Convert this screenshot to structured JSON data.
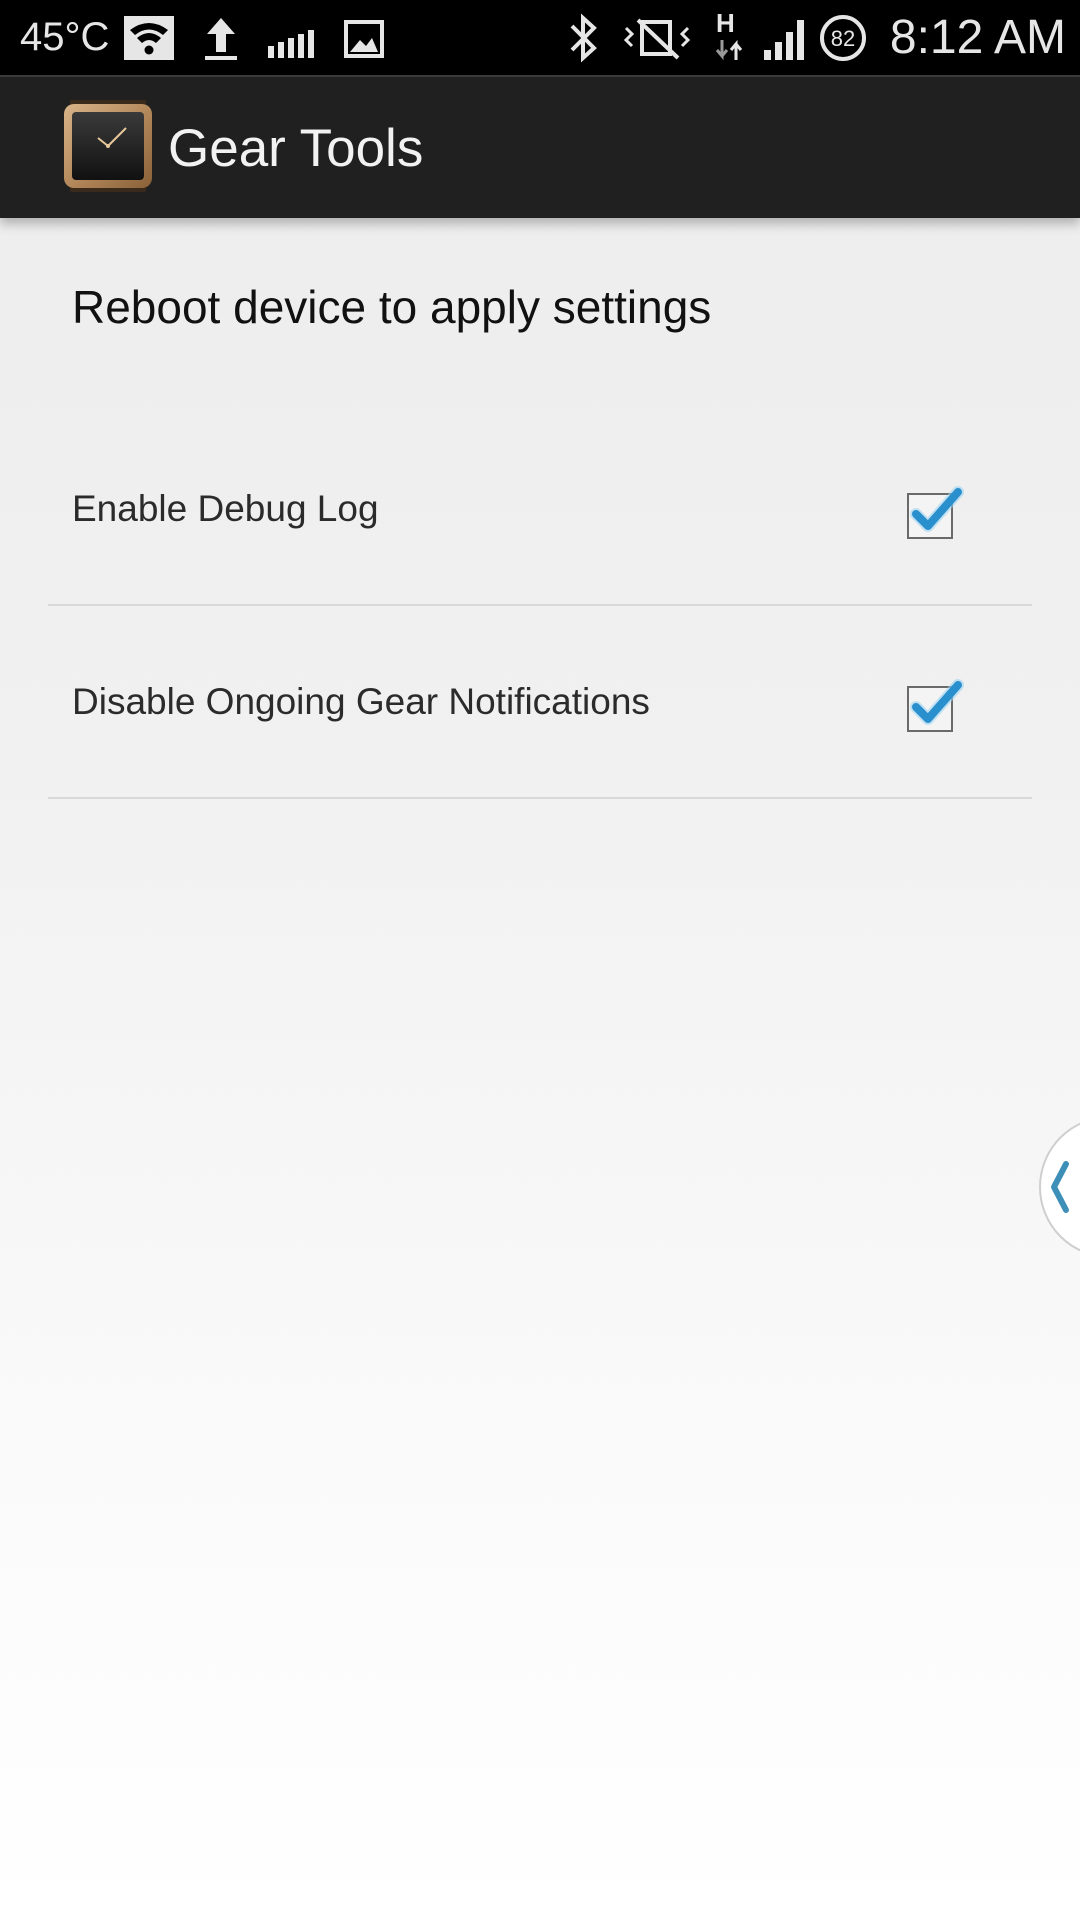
{
  "status_bar": {
    "temperature": "45°C",
    "battery_level": "82",
    "time": "8:12 AM",
    "icons": [
      "wifi-icon",
      "upload-icon",
      "signal-bars-icon",
      "gallery-icon",
      "bluetooth-icon",
      "mute-vibrate-icon",
      "hspa-data-icon",
      "cell-signal-icon",
      "battery-icon"
    ]
  },
  "action_bar": {
    "title": "Gear Tools",
    "icon": "gear-watch-icon"
  },
  "content": {
    "hint": "Reboot device to apply settings",
    "preferences": [
      {
        "label": "Enable Debug Log",
        "checked": true
      },
      {
        "label": "Disable Ongoing Gear Notifications",
        "checked": true
      }
    ]
  },
  "side_handle": {
    "icon": "chevron-left-icon"
  },
  "colors": {
    "accent": "#2a8fcd",
    "action_bar": "#202020",
    "status_bar": "#000000"
  }
}
